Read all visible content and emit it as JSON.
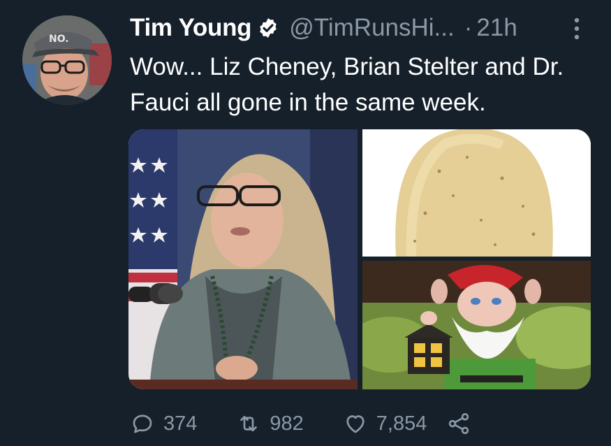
{
  "tweet": {
    "author_name": "Tim Young",
    "author_handle": "@TimRunsHi...",
    "separator": "·",
    "timestamp": "21h",
    "text": "Wow... Liz Cheney, Brian Stelter and Dr. Fauci all gone in the same week."
  },
  "avatar": {
    "hat_text": "NO."
  },
  "media": {
    "count": 3,
    "images": [
      "person-at-podium-photo",
      "potato-photo",
      "garden-gnome-photo"
    ]
  },
  "actions": {
    "replies": "374",
    "retweets": "982",
    "likes": "7,854"
  },
  "colors": {
    "background": "#15202b",
    "secondary_text": "#8b98a5",
    "primary_text": "#ffffff"
  },
  "icons": [
    "verified-badge-icon",
    "more-options-icon",
    "reply-icon",
    "retweet-icon",
    "like-icon",
    "share-icon"
  ]
}
